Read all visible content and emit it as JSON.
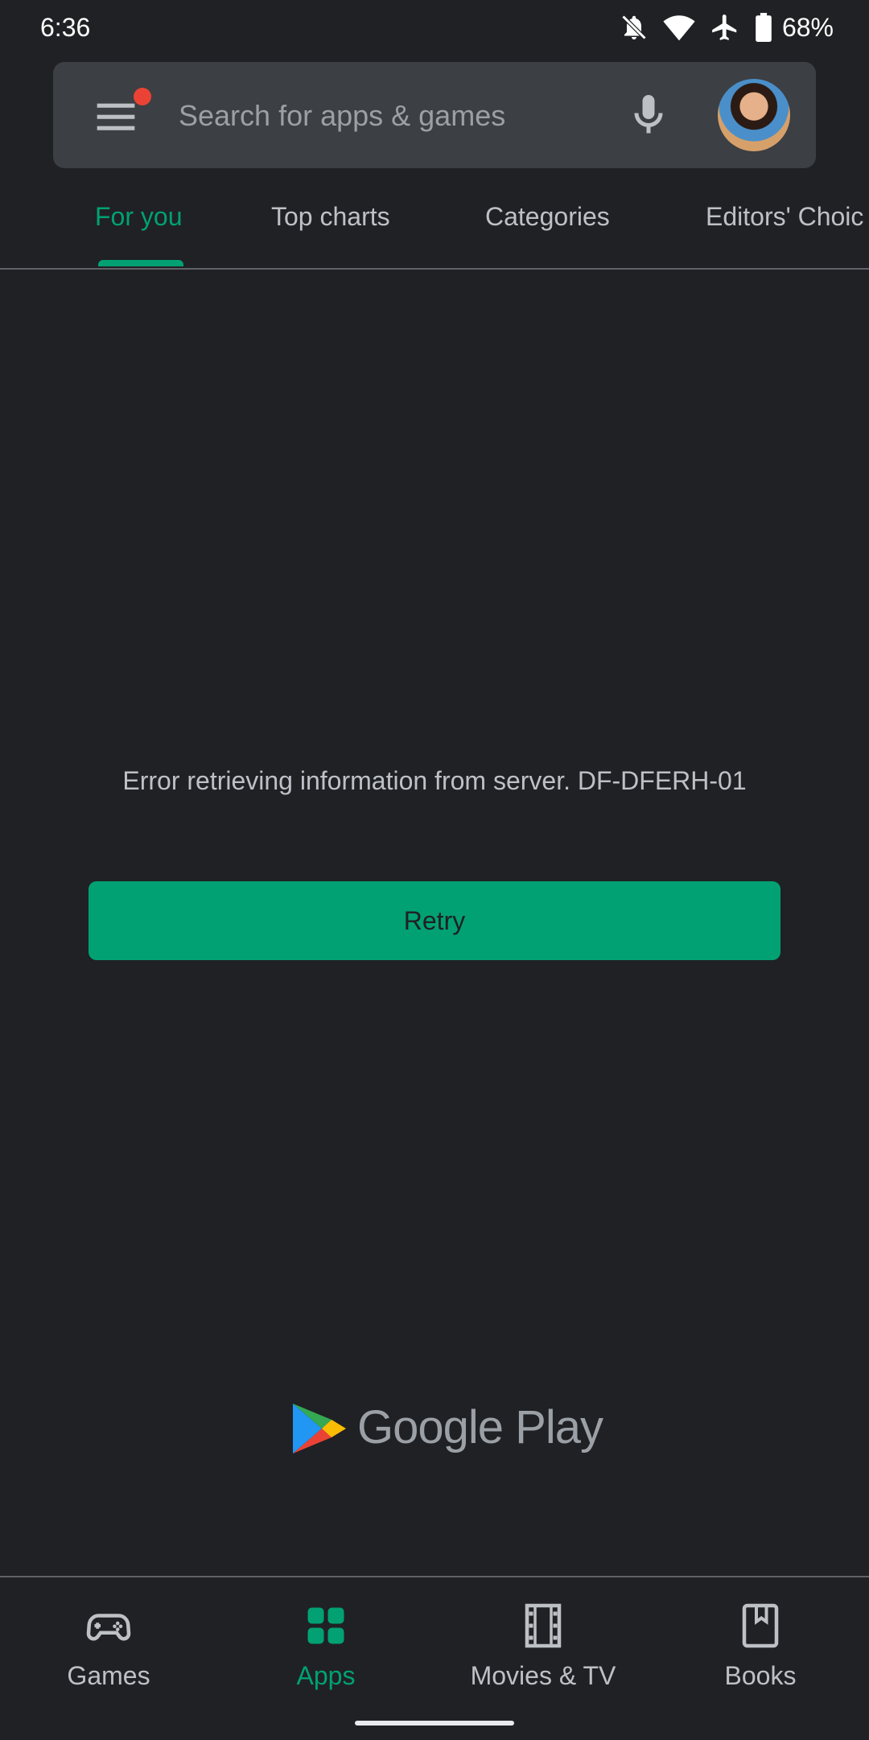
{
  "status_bar": {
    "time": "6:36",
    "battery": "68%",
    "icons": [
      "notifications-off-icon",
      "wifi-icon",
      "airplane-mode-icon",
      "battery-icon"
    ]
  },
  "search": {
    "placeholder": "Search for apps & games",
    "value": ""
  },
  "tabs": [
    {
      "label": "For you",
      "active": true
    },
    {
      "label": "Top charts",
      "active": false
    },
    {
      "label": "Categories",
      "active": false
    },
    {
      "label": "Editors' Choic",
      "active": false
    }
  ],
  "error": {
    "message": "Error retrieving information from server. DF-DFERH-01",
    "retry_label": "Retry"
  },
  "logo": {
    "wordmark": "Google Play"
  },
  "bottom_nav": [
    {
      "label": "Games",
      "icon": "gamepad-icon",
      "active": false
    },
    {
      "label": "Apps",
      "icon": "apps-grid-icon",
      "active": true
    },
    {
      "label": "Movies & TV",
      "icon": "film-icon",
      "active": false
    },
    {
      "label": "Books",
      "icon": "book-icon",
      "active": false
    }
  ],
  "colors": {
    "background": "#202124",
    "accent": "#01a173",
    "search_bar": "#3c3f43",
    "notification_dot": "#ea4335"
  }
}
